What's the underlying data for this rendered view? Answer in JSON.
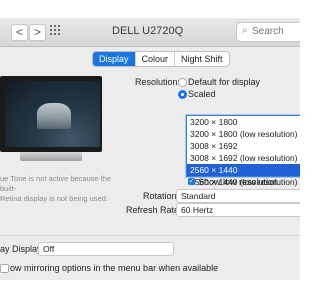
{
  "window": {
    "title": "DELL U2720Q"
  },
  "toolbar": {
    "back_glyph": "<",
    "forward_glyph": ">",
    "grid_icon": "grid-icon",
    "search_placeholder": "Search",
    "search_icon": "magnifier-icon"
  },
  "tabs": [
    {
      "label": "Display",
      "active": true
    },
    {
      "label": "Colour",
      "active": false
    },
    {
      "label": "Night Shift",
      "active": false
    }
  ],
  "true_tone_note": "ue Tone is not active because the built-\nRetina display is not being used.",
  "resolution": {
    "label": "Resolution:",
    "option_default": "Default for display",
    "option_scaled": "Scaled",
    "selected_option": "Scaled",
    "list": [
      {
        "label": "3200 × 1800",
        "selected": false
      },
      {
        "label": "3200 × 1800 (low resolution)",
        "selected": false
      },
      {
        "label": "3008 × 1692",
        "selected": false
      },
      {
        "label": "3008 × 1692 (low resolution)",
        "selected": false
      },
      {
        "label": "2560 × 1440",
        "selected": true
      },
      {
        "label": "2560 × 1440 (low resolution)",
        "selected": false
      }
    ],
    "show_low_res_label": "Show low resolution modes",
    "show_low_res_checked": true
  },
  "rotation": {
    "label": "Rotation:",
    "value": "Standard"
  },
  "refresh_rate": {
    "label": "Refresh Rate:",
    "value": "60 Hertz"
  },
  "airplay": {
    "label": "ay Display:",
    "value": "Off"
  },
  "mirroring": {
    "label": "ow mirroring options in the menu bar when available",
    "checked": false
  },
  "colors": {
    "accent": "#1976e3",
    "selection": "#2161d6",
    "window_bg": "#ececec"
  }
}
